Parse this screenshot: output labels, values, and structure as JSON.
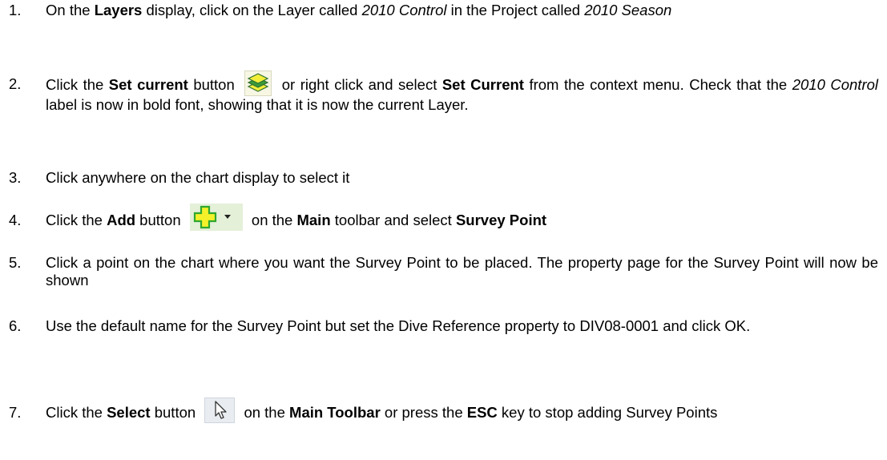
{
  "steps": [
    {
      "number": "1.",
      "parts": {
        "p1": "On the ",
        "b1": "Layers",
        "p2": " display, click on the Layer called ",
        "i1": "2010 Control",
        "p3": " in the Project called ",
        "i2": "2010 Season"
      }
    },
    {
      "number": "2.",
      "parts": {
        "p1": "Click the ",
        "b1": "Set current",
        "p2": " button ",
        "p3": " or right click and select ",
        "b2": "Set Current",
        "p4": " from the context menu.  Check that the ",
        "i1": "2010 Control",
        "p5": " label is now in bold font, showing that it is now the current Layer."
      },
      "icon": "set-current-layers-icon"
    },
    {
      "number": "3.",
      "parts": {
        "p1": "Click anywhere on the chart display to select it"
      }
    },
    {
      "number": "4.",
      "parts": {
        "p1": "Click the ",
        "b1": "Add",
        "p2": " button ",
        "p3": " on the ",
        "b2": "Main",
        "p4": " toolbar and select ",
        "b3": "Survey Point"
      },
      "icon": "add-plus-dropdown-icon"
    },
    {
      "number": "5.",
      "parts": {
        "p1": "Click a point on the chart where you want the Survey Point to be placed.  The property page for the Survey Point will now be shown"
      }
    },
    {
      "number": "6.",
      "parts": {
        "p1": "Use the default name for the Survey Point but set the Dive Reference property to DIV08-0001 and click OK."
      }
    },
    {
      "number": "7.",
      "parts": {
        "p1": "Click the ",
        "b1": "Select",
        "p2": " button ",
        "p3": " on the ",
        "b2": "Main Toolbar",
        "p4": " or press the ",
        "b3": "ESC",
        "p5": " key to stop adding Survey Points"
      },
      "icon": "select-arrow-icon"
    }
  ],
  "colors": {
    "text": "#000000",
    "add_icon_green": "#2fa82f",
    "add_icon_yellow": "#f4f12a",
    "layers_icon_green": "#3a9a3a",
    "layers_icon_yellow": "#f2ee3a"
  }
}
